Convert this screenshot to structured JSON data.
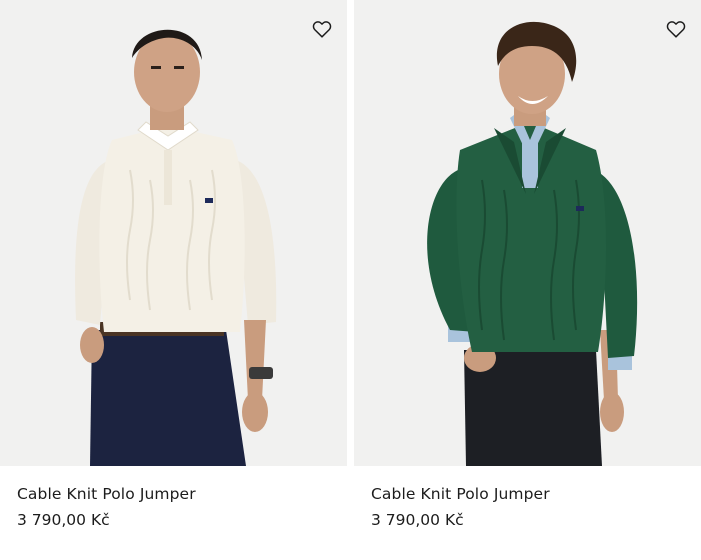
{
  "products": [
    {
      "name": "Cable Knit Polo Jumper",
      "price": "3 790,00 Kč",
      "color": "#f3efe4",
      "wishlist_icon": "heart-outline-icon"
    },
    {
      "name": "Cable Knit Polo Jumper",
      "price": "3 790,00 Kč",
      "color": "#1f5a3e",
      "wishlist_icon": "heart-outline-icon"
    }
  ]
}
